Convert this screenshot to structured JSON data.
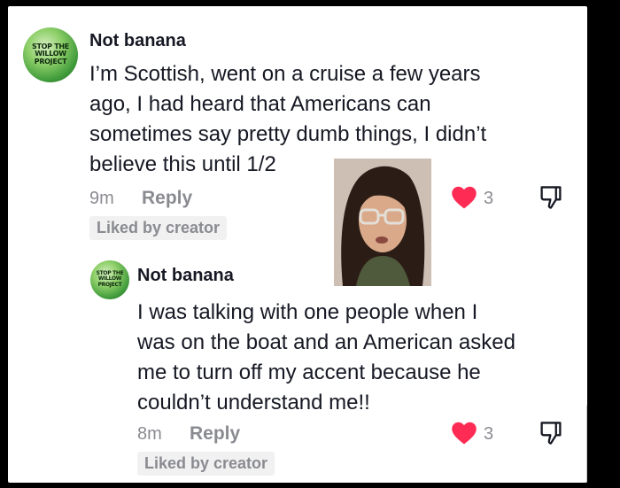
{
  "comments": [
    {
      "author": "Not banana",
      "avatar_text": "STOP THE WILLOW PROJECT",
      "lines": [
        "I’m Scottish, went on a cruise a few years",
        "ago, I had heard that Americans can",
        "sometimes say pretty dumb things, I didn’t",
        "believe this until 1/2"
      ],
      "time": "9m",
      "reply_label": "Reply",
      "liked_badge": "Liked by creator",
      "likes": "3"
    },
    {
      "author": "Not banana",
      "avatar_text": "STOP THE WILLOW PROJECT",
      "lines": [
        "I was talking with one people when I",
        "was on the boat and an American asked",
        "me to turn off my accent because he",
        "couldn’t understand me!!"
      ],
      "time": "8m",
      "reply_label": "Reply",
      "liked_badge": "Liked by creator",
      "likes": "3"
    }
  ],
  "colors": {
    "heart": "#fe2c55",
    "secondary_text": "#8a8b91",
    "primary_text": "#161823"
  }
}
